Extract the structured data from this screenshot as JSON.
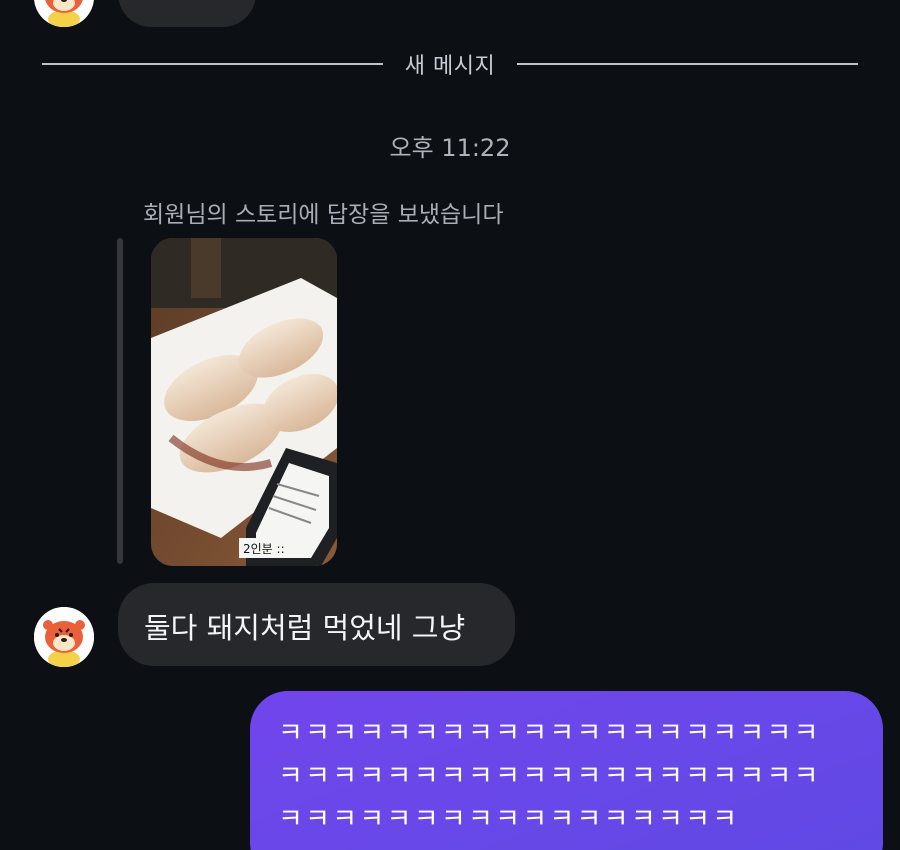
{
  "divider": {
    "label": "새 메시지"
  },
  "timestamp": "오후 11:22",
  "story_reply": {
    "caption": "회원님의 스토리에 답장을 보냈습니다",
    "receipt_label": "2인분 ::"
  },
  "messages": {
    "incoming_text": "둘다 돼지처럼 먹었네 그냥",
    "outgoing_lines": [
      "ㅋㅋㅋㅋㅋㅋㅋㅋㅋㅋㅋㅋㅋㅋㅋㅋㅋㅋㅋㅋ",
      "ㅋㅋㅋㅋㅋㅋㅋㅋㅋㅋㅋㅋㅋㅋㅋㅋㅋㅋㅋㅋ",
      "ㅋㅋㅋㅋㅋㅋㅋㅋㅋㅋㅋㅋㅋㅋㅋㅋㅋ"
    ]
  },
  "colors": {
    "background": "#0c0f14",
    "incoming_bubble": "#26282c",
    "outgoing_bubble": "#6a48ea"
  }
}
